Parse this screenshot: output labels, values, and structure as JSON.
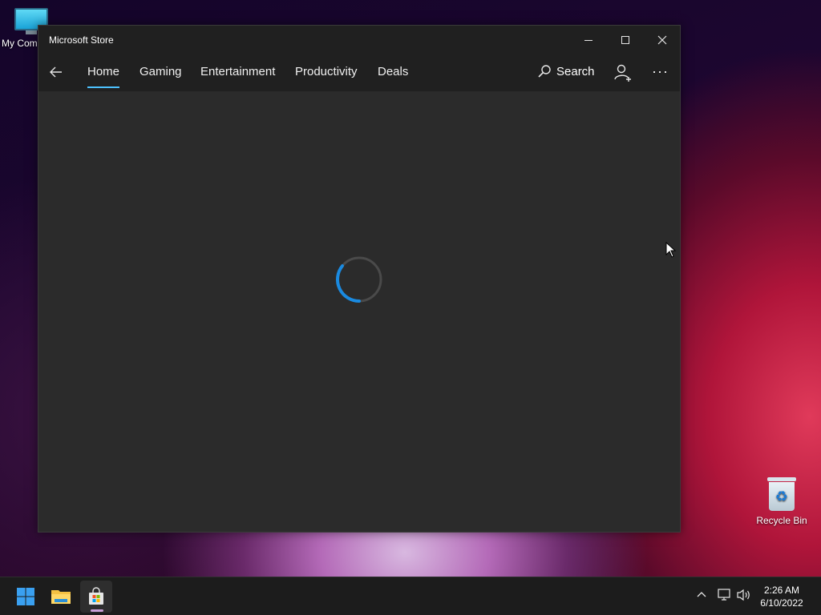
{
  "desktop": {
    "icons": [
      {
        "label": "My Com",
        "icon": "computer-icon"
      },
      {
        "label": "Recycle Bin",
        "icon": "recycle-bin-icon"
      }
    ]
  },
  "window": {
    "title": "Microsoft Store",
    "controls": {
      "minimize": "minimize-icon",
      "maximize": "maximize-icon",
      "close": "close-icon"
    }
  },
  "nav": {
    "back_icon": "back-arrow-icon",
    "items": [
      "Home",
      "Gaming",
      "Entertainment",
      "Productivity",
      "Deals"
    ],
    "active": "Home",
    "search_label": "Search",
    "account_icon": "add-account-icon",
    "more_icon": "more-icon"
  },
  "content": {
    "state": "loading",
    "spinner_icon": "loading-spinner-icon"
  },
  "taskbar": {
    "apps": [
      {
        "icon": "windows-start-icon"
      },
      {
        "icon": "file-explorer-icon"
      },
      {
        "icon": "microsoft-store-icon",
        "active": true
      }
    ],
    "tray": [
      "chevron-up-icon",
      "network-icon",
      "volume-icon"
    ],
    "time": "2:26 AM",
    "date": "6/10/2022"
  },
  "colors": {
    "accent": "#4cc2ff",
    "spinner": "#1a8ae0",
    "window_bg": "#2b2b2b",
    "titlebar_bg": "#202020",
    "taskbar_bg": "#1c1c1c"
  }
}
